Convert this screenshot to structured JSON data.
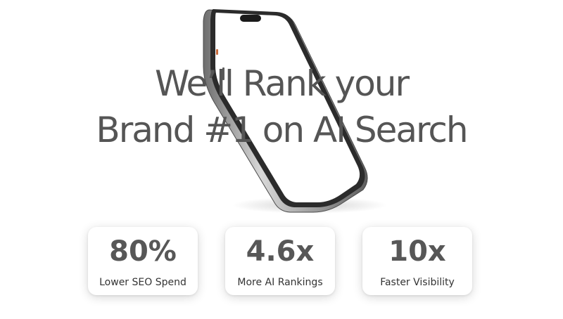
{
  "hero": {
    "headline_line1": "We’ll  Rank your",
    "headline_line2": "Brand #1 on AI  Search"
  },
  "stats": [
    {
      "value": "80%",
      "label": "Lower SEO Spend"
    },
    {
      "value": "4.6x",
      "label": "More AI Rankings"
    },
    {
      "value": "10x",
      "label": "Faster Visibility"
    }
  ],
  "colors": {
    "text_primary": "#555555",
    "phone_frame": "#8e8e8e",
    "background": "#ffffff"
  }
}
